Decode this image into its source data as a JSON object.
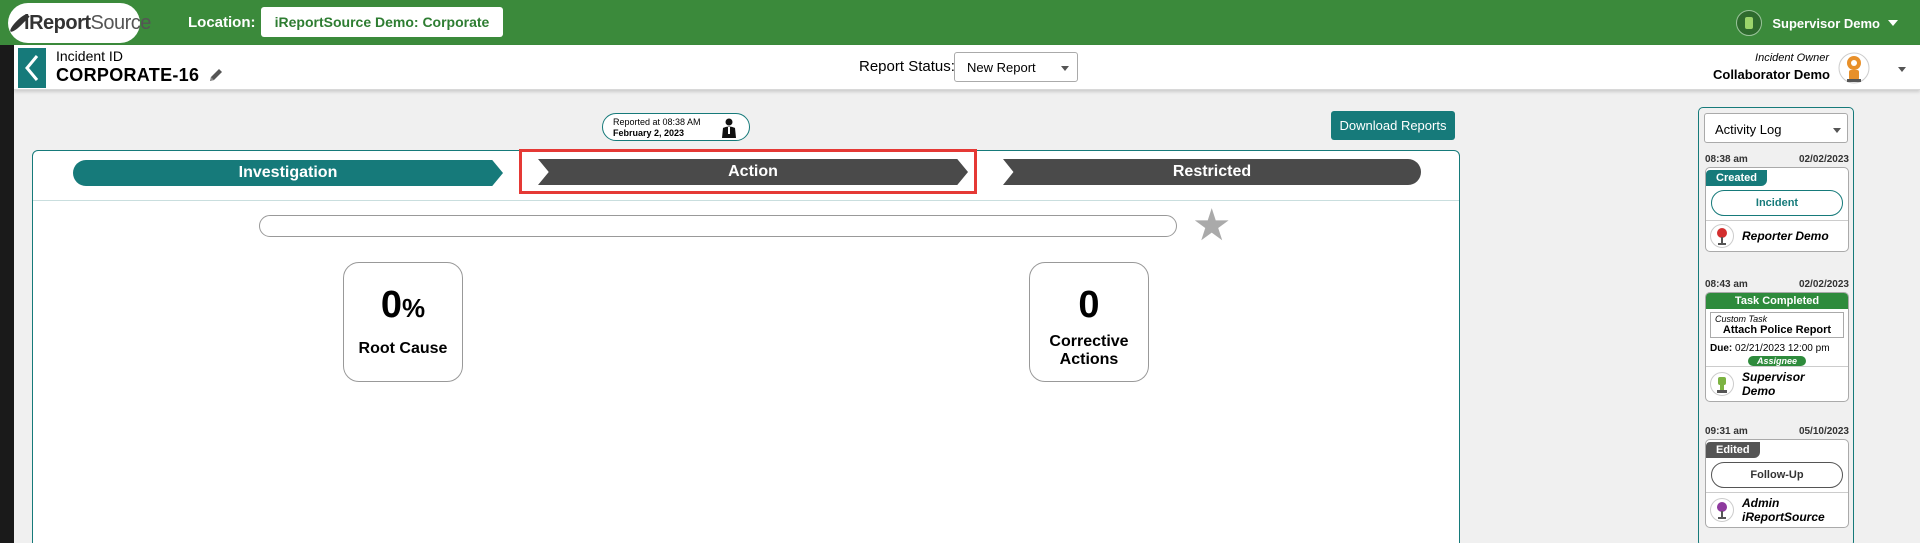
{
  "topbar": {
    "logo_text_bold": "i",
    "logo_text_main": "Report",
    "logo_text_light": "Source",
    "location_label": "Location:",
    "location_value": "iReportSource Demo: Corporate",
    "user_name": "Supervisor Demo"
  },
  "subheader": {
    "incident_label": "Incident ID",
    "incident_id": "CORPORATE-16",
    "status_label": "Report Status:",
    "status_value": "New Report",
    "owner_label": "Incident Owner",
    "owner_name": "Collaborator Demo"
  },
  "reported": {
    "line1": "Reported at 08:38 AM",
    "line2": "February 2, 2023"
  },
  "download_label": "Download Reports",
  "tabs": [
    {
      "label": "Investigation",
      "active": true
    },
    {
      "label": "Action",
      "active": false
    },
    {
      "label": "Restricted",
      "active": false
    }
  ],
  "progress": {
    "fraction": 0
  },
  "stats": {
    "root_cause_value": "0",
    "root_cause_unit": "%",
    "root_cause_label": "Root Cause",
    "corrective_value": "0",
    "corrective_label_1": "Corrective",
    "corrective_label_2": "Actions"
  },
  "activity": {
    "select_value": "Activity Log",
    "entries": [
      {
        "time": "08:38 am",
        "date": "02/02/2023",
        "badge": "Created",
        "button": "Incident",
        "person": "Reporter Demo"
      },
      {
        "time": "08:43 am",
        "date": "02/02/2023",
        "badge": "Task Completed",
        "task_type": "Custom Task",
        "task_name": "Attach Police Report",
        "due_label": "Due:",
        "due_value": "02/21/2023 12:00 pm",
        "role": "Assignee",
        "person_1": "Supervisor",
        "person_2": "Demo"
      },
      {
        "time": "09:31 am",
        "date": "05/10/2023",
        "badge": "Edited",
        "button": "Follow-Up",
        "person_1": "Admin",
        "person_2": "iReportSource"
      }
    ]
  },
  "colors": {
    "topbar": "#3b8a3b",
    "teal": "#167a7a",
    "tab_dark": "#4a4a4a",
    "highlight": "#e53935"
  }
}
